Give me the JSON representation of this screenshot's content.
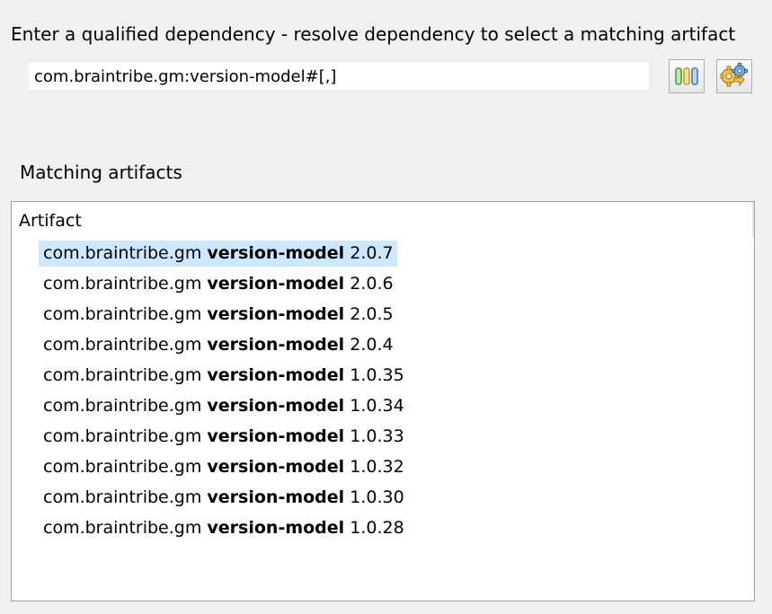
{
  "instruction": "Enter a qualified dependency - resolve dependency to select a matching artifact",
  "dependency_input": {
    "value": "com.braintribe.gm:version-model#[,]"
  },
  "toolbar": {
    "versions_button_icon": "version-bars-icon",
    "resolve_button_icon": "resolve-gears-icon"
  },
  "matching_label": "Matching artifacts",
  "table": {
    "header": "Artifact",
    "rows": [
      {
        "group": "com.braintribe.gm",
        "artifact": "version-model",
        "version": "2.0.7",
        "selected": true
      },
      {
        "group": "com.braintribe.gm",
        "artifact": "version-model",
        "version": "2.0.6"
      },
      {
        "group": "com.braintribe.gm",
        "artifact": "version-model",
        "version": "2.0.5"
      },
      {
        "group": "com.braintribe.gm",
        "artifact": "version-model",
        "version": "2.0.4"
      },
      {
        "group": "com.braintribe.gm",
        "artifact": "version-model",
        "version": "1.0.35"
      },
      {
        "group": "com.braintribe.gm",
        "artifact": "version-model",
        "version": "1.0.34"
      },
      {
        "group": "com.braintribe.gm",
        "artifact": "version-model",
        "version": "1.0.33"
      },
      {
        "group": "com.braintribe.gm",
        "artifact": "version-model",
        "version": "1.0.32"
      },
      {
        "group": "com.braintribe.gm",
        "artifact": "version-model",
        "version": "1.0.30"
      },
      {
        "group": "com.braintribe.gm",
        "artifact": "version-model",
        "version": "1.0.28"
      }
    ]
  },
  "colors": {
    "background": "#f0f0f0",
    "selection": "#cce8ff",
    "border": "#a0a0a0"
  }
}
